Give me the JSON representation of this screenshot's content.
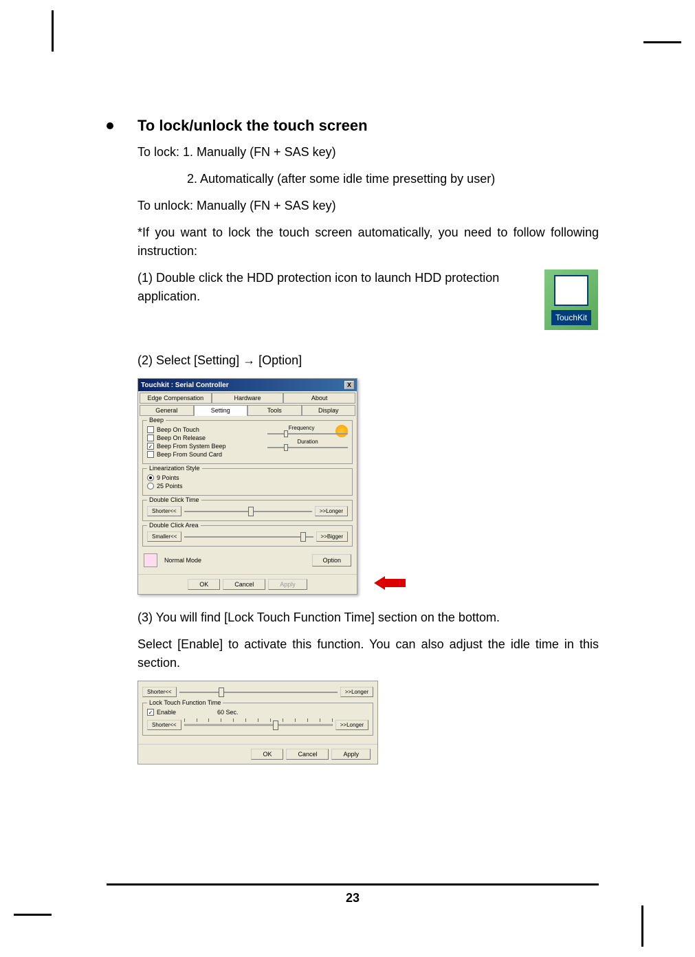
{
  "heading": "To lock/unlock the touch screen",
  "lock_intro": "To lock: 1. Manually (FN + SAS key)",
  "lock_2": "2. Automatically (after some idle time presetting by user)",
  "unlock": "To unlock: Manually (FN + SAS key)",
  "auto_note": "*If you want to lock the touch screen automatically, you need to follow following instruction:",
  "step1": "(1) Double click the HDD protection icon to launch HDD protection application.",
  "touchkit_label": "TouchKit",
  "step2": "(2) Select [Setting] → [Option]",
  "dialog1": {
    "title": "Touchkit : Serial Controller",
    "close": "X",
    "tabs_top": [
      "Edge Compensation",
      "Hardware",
      "About"
    ],
    "tabs_bottom": [
      "General",
      "Setting",
      "Tools",
      "Display"
    ],
    "beep": {
      "title": "Beep",
      "on_touch": "Beep On Touch",
      "on_release": "Beep On Release",
      "from_system": "Beep From System Beep",
      "from_sound": "Beep From Sound Card",
      "frequency": "Frequency",
      "duration": "Duration"
    },
    "linearization": {
      "title": "Linearization Style",
      "opt1": "9 Points",
      "opt2": "25 Points"
    },
    "dclick_time": {
      "title": "Double Click Time",
      "shorter": "Shorter<<",
      "longer": ">>Longer"
    },
    "dclick_area": {
      "title": "Double Click Area",
      "smaller": "Smaller<<",
      "bigger": ">>Bigger"
    },
    "mode": "Normal Mode",
    "option": "Option",
    "ok": "OK",
    "cancel": "Cancel",
    "apply": "Apply"
  },
  "step3": "(3) You will find [Lock Touch Function Time] section on the bottom.",
  "step3b": " Select [Enable] to activate this function. You can also adjust the idle time in this section.",
  "dialog2": {
    "shorter": "Shorter<<",
    "longer": ">>Longer",
    "lock_title": "Lock Touch Function Time",
    "enable": "Enable",
    "time": "60 Sec.",
    "ok": "OK",
    "cancel": "Cancel",
    "apply": "Apply"
  },
  "page_number": "23"
}
